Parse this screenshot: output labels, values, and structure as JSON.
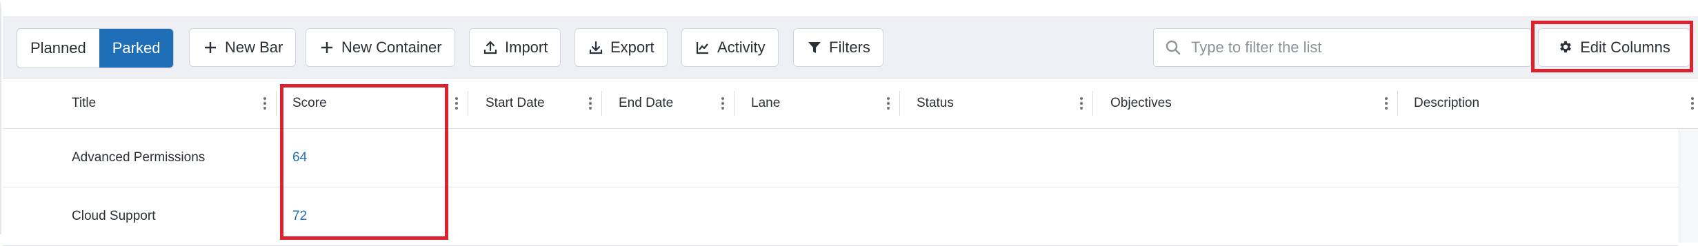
{
  "toolbar": {
    "view_toggle": {
      "planned": "Planned",
      "parked": "Parked",
      "selected": "Parked"
    },
    "buttons": {
      "new_bar": "New Bar",
      "new_container": "New Container",
      "import": "Import",
      "export": "Export",
      "activity": "Activity",
      "filters": "Filters"
    },
    "search": {
      "placeholder": "Type to filter the list",
      "value": ""
    },
    "edit_columns": "Edit Columns"
  },
  "grid": {
    "columns": [
      "Title",
      "Score",
      "Start Date",
      "End Date",
      "Lane",
      "Status",
      "Objectives",
      "Description"
    ],
    "rows": [
      {
        "title": "Advanced Permissions",
        "score": "64",
        "start_date": "",
        "end_date": "",
        "lane": "",
        "status": "",
        "objectives": "",
        "description": ""
      },
      {
        "title": "Cloud Support",
        "score": "72",
        "start_date": "",
        "end_date": "",
        "lane": "",
        "status": "",
        "objectives": "",
        "description": ""
      }
    ]
  },
  "colors": {
    "accent": "#1f6fb8",
    "highlight": "#d9232e",
    "toolbar_bg": "#eef0f3"
  }
}
